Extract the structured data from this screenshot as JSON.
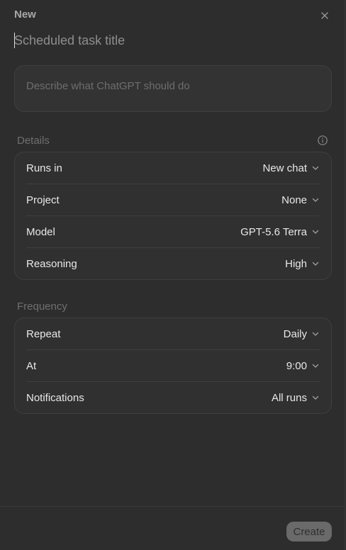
{
  "header": {
    "title": "New",
    "close_icon": "close-icon"
  },
  "task": {
    "title_placeholder": "Scheduled task title",
    "title_value": "",
    "description_placeholder": "Describe what ChatGPT should do",
    "description_value": ""
  },
  "details": {
    "label": "Details",
    "info_icon": "info-icon",
    "rows": [
      {
        "label": "Runs in",
        "value": "New chat"
      },
      {
        "label": "Project",
        "value": "None"
      },
      {
        "label": "Model",
        "value": "GPT-5.6 Terra"
      },
      {
        "label": "Reasoning",
        "value": "High"
      }
    ]
  },
  "frequency": {
    "label": "Frequency",
    "rows": [
      {
        "label": "Repeat",
        "value": "Daily"
      },
      {
        "label": "At",
        "value": "9:00"
      },
      {
        "label": "Notifications",
        "value": "All runs"
      }
    ]
  },
  "footer": {
    "create_label": "Create"
  },
  "colors": {
    "background": "#2d2d2d",
    "card": "#303030",
    "border": "#3f3f3f",
    "text": "#e8e8e8",
    "muted": "#6f6f6f",
    "create_button": "#6a6a6a"
  }
}
